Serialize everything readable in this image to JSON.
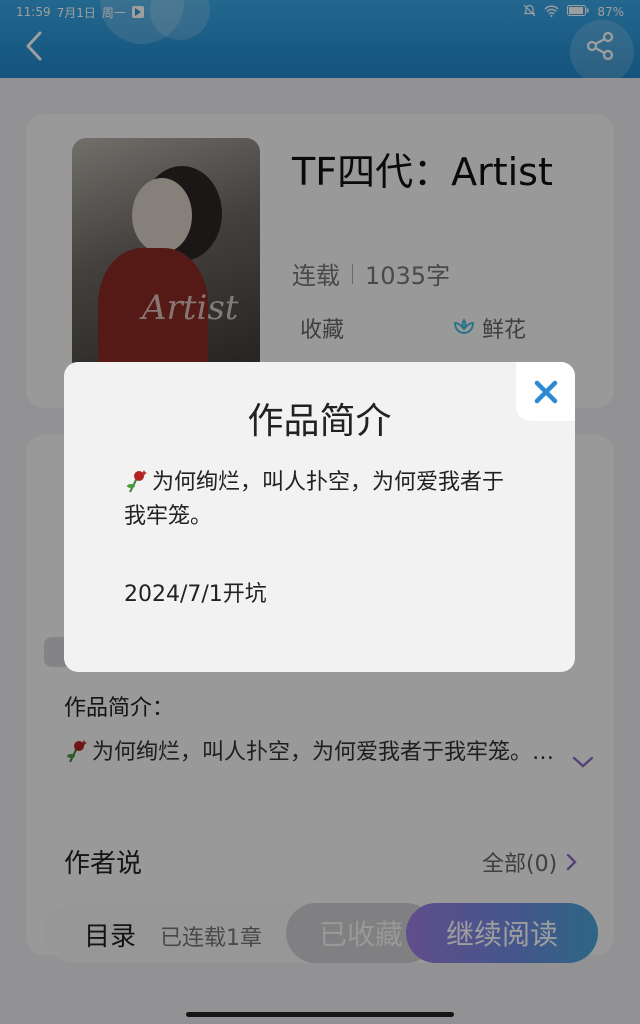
{
  "status_bar": {
    "time": "11:59",
    "date": "7月1日",
    "weekday": "周一",
    "battery": "87"
  },
  "header": {
    "back_icon": "chevron-left-icon",
    "share_icon": "share-icon"
  },
  "book": {
    "title": "TF四代：Artist",
    "status": "连载",
    "word_count": "1035字",
    "cover_script": "Artist",
    "stats": {
      "favorites_label": "收藏",
      "flowers_label": "鲜花"
    }
  },
  "intro_section": {
    "label": "作品简介：",
    "text": "为何绚烂，叫人扑空，为何爱我者于我牢笼。…"
  },
  "author_section": {
    "label": "作者说",
    "all_label": "全部(0)"
  },
  "bottom_bar": {
    "toc_label": "目录",
    "chapter_status": "已连载1章",
    "favorite_button": "已收藏",
    "read_button": "继续阅读"
  },
  "modal": {
    "title": "作品简介",
    "body": "为何绚烂，叫人扑空，为何爱我者于我牢笼。",
    "date_line": "2024/7/1开坑",
    "close_icon": "close-icon"
  },
  "colors": {
    "header_blue": "#2a96d8",
    "close_blue": "#2a8ad6",
    "accent_purple": "#8a6cc2"
  }
}
